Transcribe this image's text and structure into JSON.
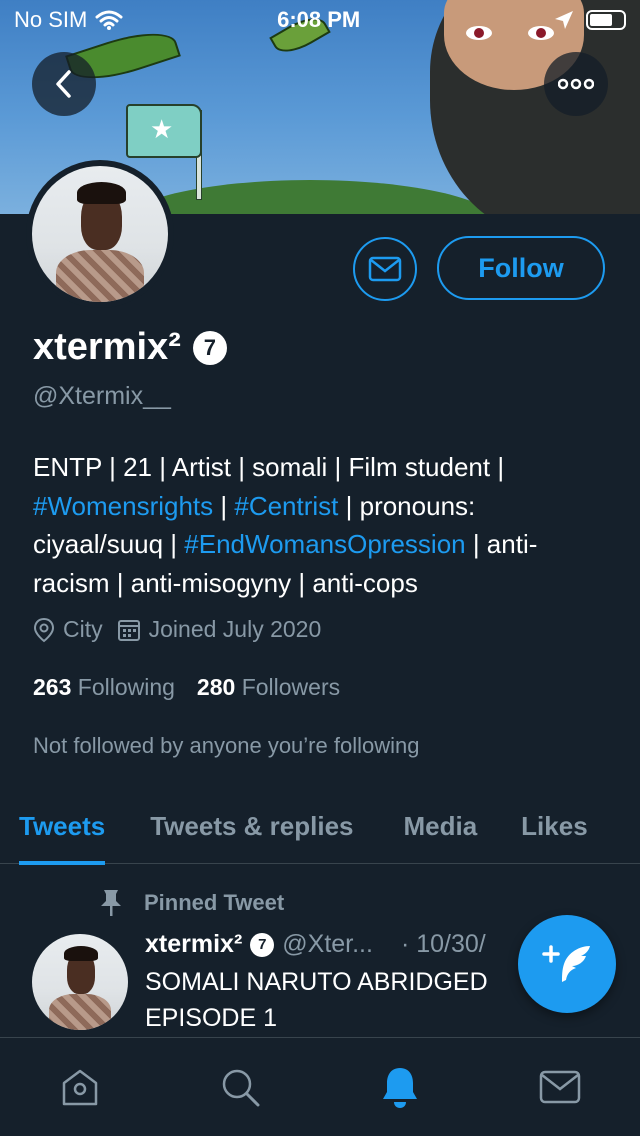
{
  "status_bar": {
    "carrier": "No SIM",
    "time": "6:08 PM"
  },
  "header": {
    "back_icon": "chevron-left-icon",
    "more_icon": "more-horizontal-icon"
  },
  "profile": {
    "display_name": "xtermix²",
    "badge_number": "7",
    "handle": "@Xtermix__",
    "bio": {
      "line1": "ENTP | 21 | Artist | somali | Film student |",
      "tag1": "#Womensrights",
      "sep1": " | ",
      "tag2": "#Centrist",
      "after_tag2": " | pronouns:",
      "line3_start": "ciyaal/suuq | ",
      "tag3": "#EndWomansOpression",
      "line3_end": " | anti-",
      "line4": "racism | anti-misogyny | anti-cops"
    },
    "location": "City",
    "joined": "Joined July 2020",
    "following_count": "263",
    "following_label": "Following",
    "followers_count": "280",
    "followers_label": "Followers",
    "followed_by": "Not followed by anyone you’re following"
  },
  "actions": {
    "follow_label": "Follow",
    "message_icon": "mail-icon"
  },
  "tabs": [
    {
      "label": "Tweets",
      "active": true
    },
    {
      "label": "Tweets & replies",
      "active": false
    },
    {
      "label": "Media",
      "active": false
    },
    {
      "label": "Likes",
      "active": false
    }
  ],
  "pinned_tweet": {
    "pinned_label": "Pinned Tweet",
    "author_name": "xtermix²",
    "badge_number": "7",
    "author_handle": "@Xter...",
    "date": "· 10/30/",
    "text_line1": "SOMALI NARUTO ABRIDGED",
    "text_line2": "EPISODE 1"
  },
  "bottom_nav": [
    {
      "name": "home-icon",
      "active": false
    },
    {
      "name": "search-icon",
      "active": false
    },
    {
      "name": "bell-icon",
      "active": true
    },
    {
      "name": "mail-icon",
      "active": false
    }
  ],
  "colors": {
    "background": "#15202b",
    "accent": "#1d9bf0",
    "secondary_text": "#8899a6",
    "divider": "#38444d"
  }
}
